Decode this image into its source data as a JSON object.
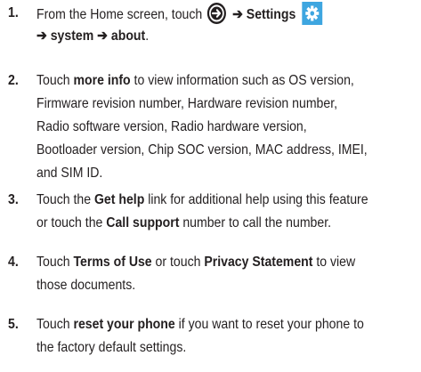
{
  "steps": [
    {
      "number": "1.",
      "line1_prefix": "From the Home screen, touch",
      "arrow_glyph": "➔",
      "settings_label": "Settings",
      "line2_arrow1": "➔",
      "line2_system": "system",
      "line2_arrow2": "➔",
      "line2_about": "about",
      "line2_period": ".",
      "icons": [
        "circle-arrow-icon",
        "settings-gear-icon"
      ]
    },
    {
      "number": "2.",
      "prefix": "Touch ",
      "bold": "more info",
      "line1_rest": " to view information such as OS version,",
      "line2": "Firmware revision number, Hardware revision number,",
      "line3": "Radio software version, Radio hardware version,",
      "line4": "Bootloader version, Chip SOC version, MAC address, IMEI,",
      "line5": "and SIM ID."
    },
    {
      "number": "3.",
      "prefix": "Touch the ",
      "bold1": "Get help",
      "line1_rest": " link for additional help using this feature",
      "line2_prefix": "or touch the ",
      "bold2": "Call support",
      "line2_rest": " number to call the number."
    },
    {
      "number": "4.",
      "prefix": "Touch ",
      "bold1": "Terms of Use",
      "middle": " or touch ",
      "bold2": "Privacy Statement",
      "line1_rest": " to view",
      "line2": "those documents."
    },
    {
      "number": "5.",
      "prefix": "Touch ",
      "bold": "reset your phone",
      "line1_rest": " if you want to reset your phone to",
      "line2": "the factory default settings."
    }
  ],
  "colors": {
    "text": "#231f20",
    "settings_icon_bg": "#3ea6e0"
  }
}
